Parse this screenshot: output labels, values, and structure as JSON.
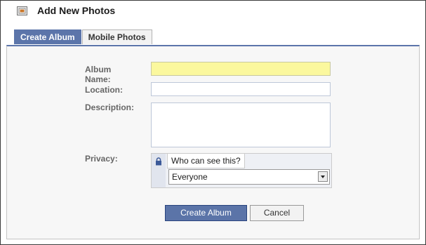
{
  "header": {
    "title": "Add New Photos",
    "icon": "photo-album-icon"
  },
  "tabs": [
    {
      "label": "Create Album",
      "active": true
    },
    {
      "label": "Mobile Photos",
      "active": false
    }
  ],
  "form": {
    "album_name_label": "Album Name:",
    "album_name_value": "",
    "location_label": "Location:",
    "location_value": "",
    "description_label": "Description:",
    "description_value": "",
    "privacy_label": "Privacy:",
    "privacy_prompt": "Who can see this?",
    "privacy_value": "Everyone"
  },
  "buttons": {
    "create": "Create Album",
    "cancel": "Cancel"
  },
  "colors": {
    "accent": "#5c75aa",
    "highlight_input": "#fbf89e",
    "primary_button": "#5b74a8"
  }
}
